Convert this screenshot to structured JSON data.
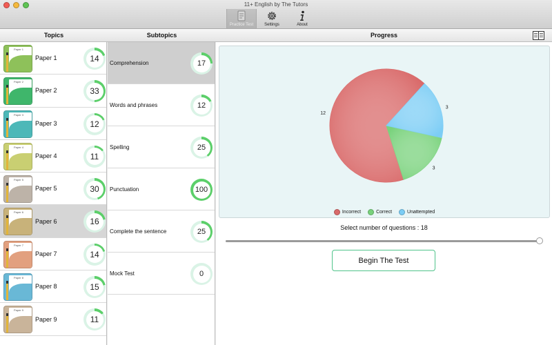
{
  "window": {
    "title": "11+ English by The Tutors"
  },
  "toolbar": {
    "items": [
      {
        "label": "Practice Test",
        "icon": "practice-test-icon",
        "active": true
      },
      {
        "label": "Settings",
        "icon": "gear-icon",
        "active": false
      },
      {
        "label": "About",
        "icon": "info-icon",
        "active": false
      }
    ]
  },
  "columns": {
    "topics": "Topics",
    "subtopics": "Subtopics",
    "progress": "Progress"
  },
  "topics": [
    {
      "label": "Paper 1",
      "thumb_title": "Paper 1",
      "count": "14",
      "fraction": 0.2,
      "color": "#8ec15a"
    },
    {
      "label": "Paper 2",
      "thumb_title": "Paper 2",
      "count": "33",
      "fraction": 0.5,
      "color": "#3fb66b"
    },
    {
      "label": "Paper 3",
      "thumb_title": "Paper 3",
      "count": "12",
      "fraction": 0.18,
      "color": "#4db8b8"
    },
    {
      "label": "Paper 4",
      "thumb_title": "Paper 4",
      "count": "11",
      "fraction": 0.15,
      "color": "#c9cf72"
    },
    {
      "label": "Paper 5",
      "thumb_title": "Paper 5",
      "count": "30",
      "fraction": 0.45,
      "color": "#bdb3a8"
    },
    {
      "label": "Paper 6",
      "thumb_title": "Paper 6",
      "count": "16",
      "fraction": 0.22,
      "color": "#c8b27a"
    },
    {
      "label": "Paper 7",
      "thumb_title": "Paper 7",
      "count": "14",
      "fraction": 0.2,
      "color": "#e2a07f"
    },
    {
      "label": "Paper 8",
      "thumb_title": "Paper 8",
      "count": "15",
      "fraction": 0.22,
      "color": "#69b8d6"
    },
    {
      "label": "Paper 9",
      "thumb_title": "Paper 9",
      "count": "11",
      "fraction": 0.15,
      "color": "#c9b49a"
    }
  ],
  "selected_topic": 5,
  "subtopics": [
    {
      "label": "Comprehension",
      "count": "17",
      "fraction": 0.25
    },
    {
      "label": "Words and phrases",
      "count": "12",
      "fraction": 0.18
    },
    {
      "label": "Spelling",
      "count": "25",
      "fraction": 0.4
    },
    {
      "label": "Punctuation",
      "count": "100",
      "fraction": 1.0
    },
    {
      "label": "Complete the sentence",
      "count": "25",
      "fraction": 0.4
    },
    {
      "label": "Mock Test",
      "count": "0",
      "fraction": 0
    }
  ],
  "selected_subtopic": 0,
  "chart_data": {
    "type": "pie",
    "slices": [
      {
        "name": "Incorrect",
        "value": 12,
        "color": "#d96a6a"
      },
      {
        "name": "Correct",
        "value": 3,
        "color": "#79d27c"
      },
      {
        "name": "Unattempted",
        "value": 3,
        "color": "#7ccdf5"
      }
    ],
    "legend_position": "bottom"
  },
  "progress": {
    "select_label": "Select number of questions : 18",
    "slider_fraction": 1.0,
    "begin_button": "Begin The Test"
  },
  "colors": {
    "ring_track": "#daf3e6",
    "ring_fill": "#5ccf6a",
    "accent": "#4fc38a"
  }
}
